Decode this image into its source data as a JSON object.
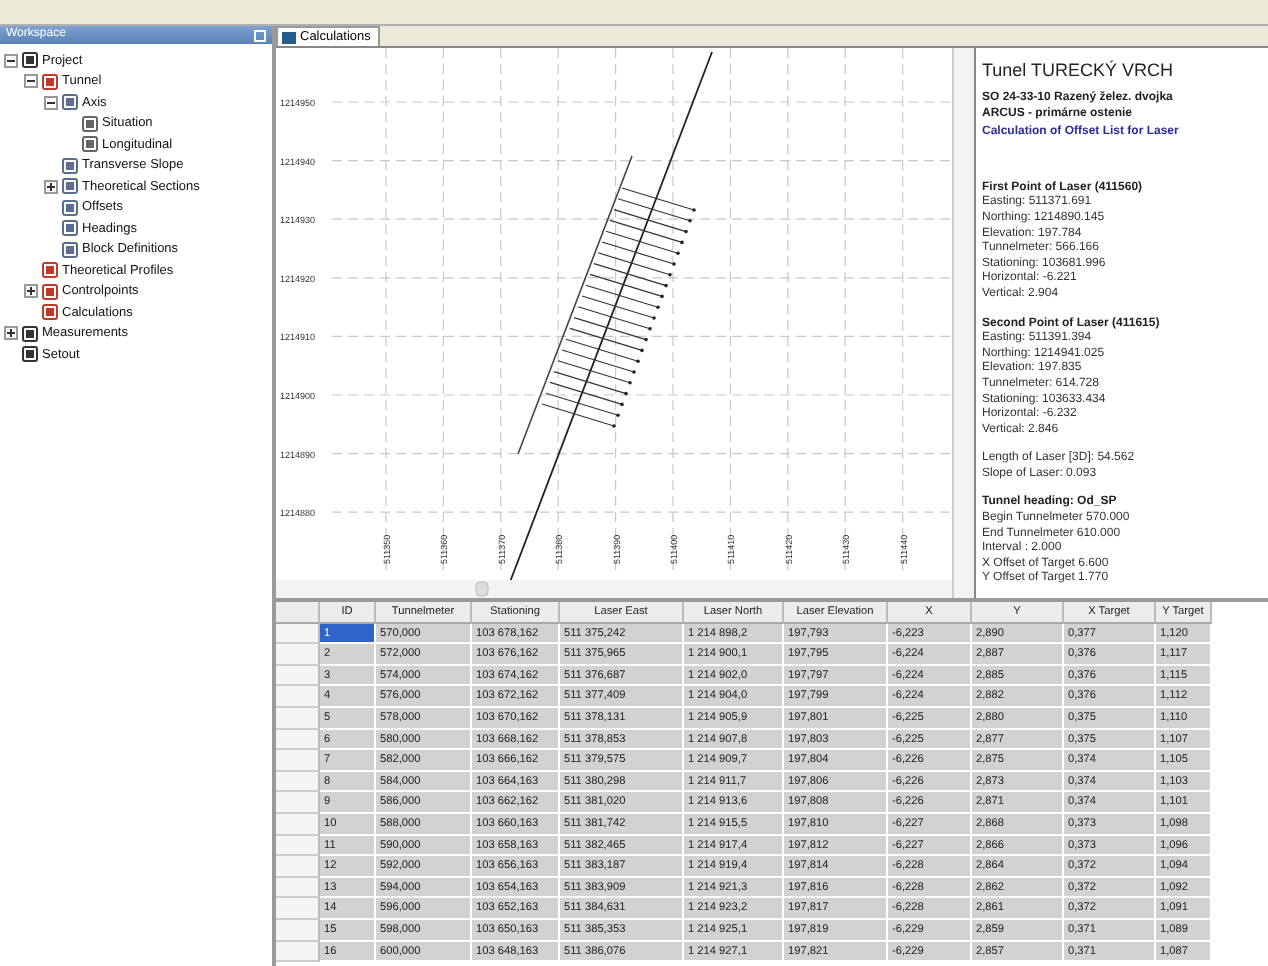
{
  "workspace": {
    "title": "Workspace",
    "tree": [
      {
        "label": "Project",
        "expanded": true,
        "children": [
          {
            "label": "Tunnel",
            "expanded": true,
            "children": [
              {
                "label": "Axis",
                "expanded": true,
                "children": [
                  {
                    "label": "Situation"
                  },
                  {
                    "label": "Longitudinal"
                  }
                ]
              },
              {
                "label": "Transverse Slope"
              },
              {
                "label": "Theoretical Sections",
                "expanded": false
              },
              {
                "label": "Offsets"
              },
              {
                "label": "Headings"
              },
              {
                "label": "Block Definitions"
              }
            ]
          },
          {
            "label": "Theoretical Profiles"
          },
          {
            "label": "Controlpoints",
            "expanded": false
          },
          {
            "label": "Calculations"
          }
        ]
      },
      {
        "label": "Measurements",
        "expanded": false
      },
      {
        "label": "Setout"
      }
    ]
  },
  "tabs": [
    {
      "label": "Calculations",
      "selected": true
    }
  ],
  "plot": {
    "y_ticks": [
      "1214950",
      "1214940",
      "1214930",
      "1214920",
      "1214910",
      "1214900",
      "1214890",
      "1214880"
    ],
    "x_ticks": [
      "511350",
      "511360",
      "511370",
      "511380",
      "511390",
      "511400",
      "511410",
      "511420",
      "511430",
      "511440"
    ]
  },
  "report": {
    "title": "Tunel TURECKÝ VRCH",
    "subtitle_lines": [
      "SO 24-33-10 Razený želez. dvojka",
      "ARCUS - primárne ostenie"
    ],
    "link": "Calculation of Offset List for Laser",
    "sections": [
      {
        "heading": "First Point of Laser (411560)",
        "lines": [
          "Easting: 511371.691",
          "Northing: 1214890.145",
          "Elevation: 197.784",
          "Tunnelmeter: 566.166",
          "Stationing: 103681.996",
          "Horizontal: -6.221",
          "Vertical: 2.904"
        ]
      },
      {
        "heading": "Second Point of Laser (411615)",
        "lines": [
          "Easting: 511391.394",
          "Northing: 1214941.025",
          "Elevation: 197.835",
          "Tunnelmeter: 614.728",
          "Stationing: 103633.434",
          "Horizontal: -6.232",
          "Vertical: 2.846"
        ]
      },
      {
        "lines": [
          "Length of Laser [3D]: 54.562",
          "Slope of Laser: 0.093"
        ]
      },
      {
        "heading": "Tunnel heading: Od_SP",
        "lines": [
          "Begin Tunnelmeter 570.000",
          "End Tunnelmeter 610.000",
          "Interval : 2.000",
          "X Offset of Target 6.600",
          "Y Offset of Target 1.770"
        ]
      }
    ]
  },
  "table": {
    "columns": [
      "ID",
      "Tunnelmeter",
      "Stationing",
      "Laser East",
      "Laser North",
      "Laser Elevation",
      "X",
      "Y",
      "X Target",
      "Y Target"
    ],
    "rows": [
      {
        "selected": true,
        "cells": [
          "1",
          "570,000",
          "103 678,162",
          "511 375,242",
          "1 214 898,2",
          "197,793",
          "-6,223",
          "2,890",
          "0,377",
          "1,120"
        ]
      },
      {
        "selected": false,
        "cells": [
          "2",
          "572,000",
          "103 676,162",
          "511 375,965",
          "1 214 900,1",
          "197,795",
          "-6,224",
          "2,887",
          "0,376",
          "1,117"
        ]
      },
      {
        "selected": false,
        "cells": [
          "3",
          "574,000",
          "103 674,162",
          "511 376,687",
          "1 214 902,0",
          "197,797",
          "-6,224",
          "2,885",
          "0,376",
          "1,115"
        ]
      },
      {
        "selected": false,
        "cells": [
          "4",
          "576,000",
          "103 672,162",
          "511 377,409",
          "1 214 904,0",
          "197,799",
          "-6,224",
          "2,882",
          "0,376",
          "1,112"
        ]
      },
      {
        "selected": false,
        "cells": [
          "5",
          "578,000",
          "103 670,162",
          "511 378,131",
          "1 214 905,9",
          "197,801",
          "-6,225",
          "2,880",
          "0,375",
          "1,110"
        ]
      },
      {
        "selected": false,
        "cells": [
          "6",
          "580,000",
          "103 668,162",
          "511 378,853",
          "1 214 907,8",
          "197,803",
          "-6,225",
          "2,877",
          "0,375",
          "1,107"
        ]
      },
      {
        "selected": false,
        "cells": [
          "7",
          "582,000",
          "103 666,162",
          "511 379,575",
          "1 214 909,7",
          "197,804",
          "-6,226",
          "2,875",
          "0,374",
          "1,105"
        ]
      },
      {
        "selected": false,
        "cells": [
          "8",
          "584,000",
          "103 664,163",
          "511 380,298",
          "1 214 911,7",
          "197,806",
          "-6,226",
          "2,873",
          "0,374",
          "1,103"
        ]
      },
      {
        "selected": false,
        "cells": [
          "9",
          "586,000",
          "103 662,162",
          "511 381,020",
          "1 214 913,6",
          "197,808",
          "-6,226",
          "2,871",
          "0,374",
          "1,101"
        ]
      },
      {
        "selected": false,
        "cells": [
          "10",
          "588,000",
          "103 660,163",
          "511 381,742",
          "1 214 915,5",
          "197,810",
          "-6,227",
          "2,868",
          "0,373",
          "1,098"
        ]
      },
      {
        "selected": false,
        "cells": [
          "11",
          "590,000",
          "103 658,163",
          "511 382,465",
          "1 214 917,4",
          "197,812",
          "-6,227",
          "2,866",
          "0,373",
          "1,096"
        ]
      },
      {
        "selected": false,
        "cells": [
          "12",
          "592,000",
          "103 656,163",
          "511 383,187",
          "1 214 919,4",
          "197,814",
          "-6,228",
          "2,864",
          "0,372",
          "1,094"
        ]
      },
      {
        "selected": false,
        "cells": [
          "13",
          "594,000",
          "103 654,163",
          "511 383,909",
          "1 214 921,3",
          "197,816",
          "-6,228",
          "2,862",
          "0,372",
          "1,092"
        ]
      },
      {
        "selected": false,
        "cells": [
          "14",
          "596,000",
          "103 652,163",
          "511 384,631",
          "1 214 923,2",
          "197,817",
          "-6,228",
          "2,861",
          "0,372",
          "1,091"
        ]
      },
      {
        "selected": false,
        "cells": [
          "15",
          "598,000",
          "103 650,163",
          "511 385,353",
          "1 214 925,1",
          "197,819",
          "-6,229",
          "2,859",
          "0,371",
          "1,089"
        ]
      },
      {
        "selected": false,
        "cells": [
          "16",
          "600,000",
          "103 648,163",
          "511 386,076",
          "1 214 927,1",
          "197,821",
          "-6,229",
          "2,857",
          "0,371",
          "1,087"
        ]
      }
    ]
  }
}
